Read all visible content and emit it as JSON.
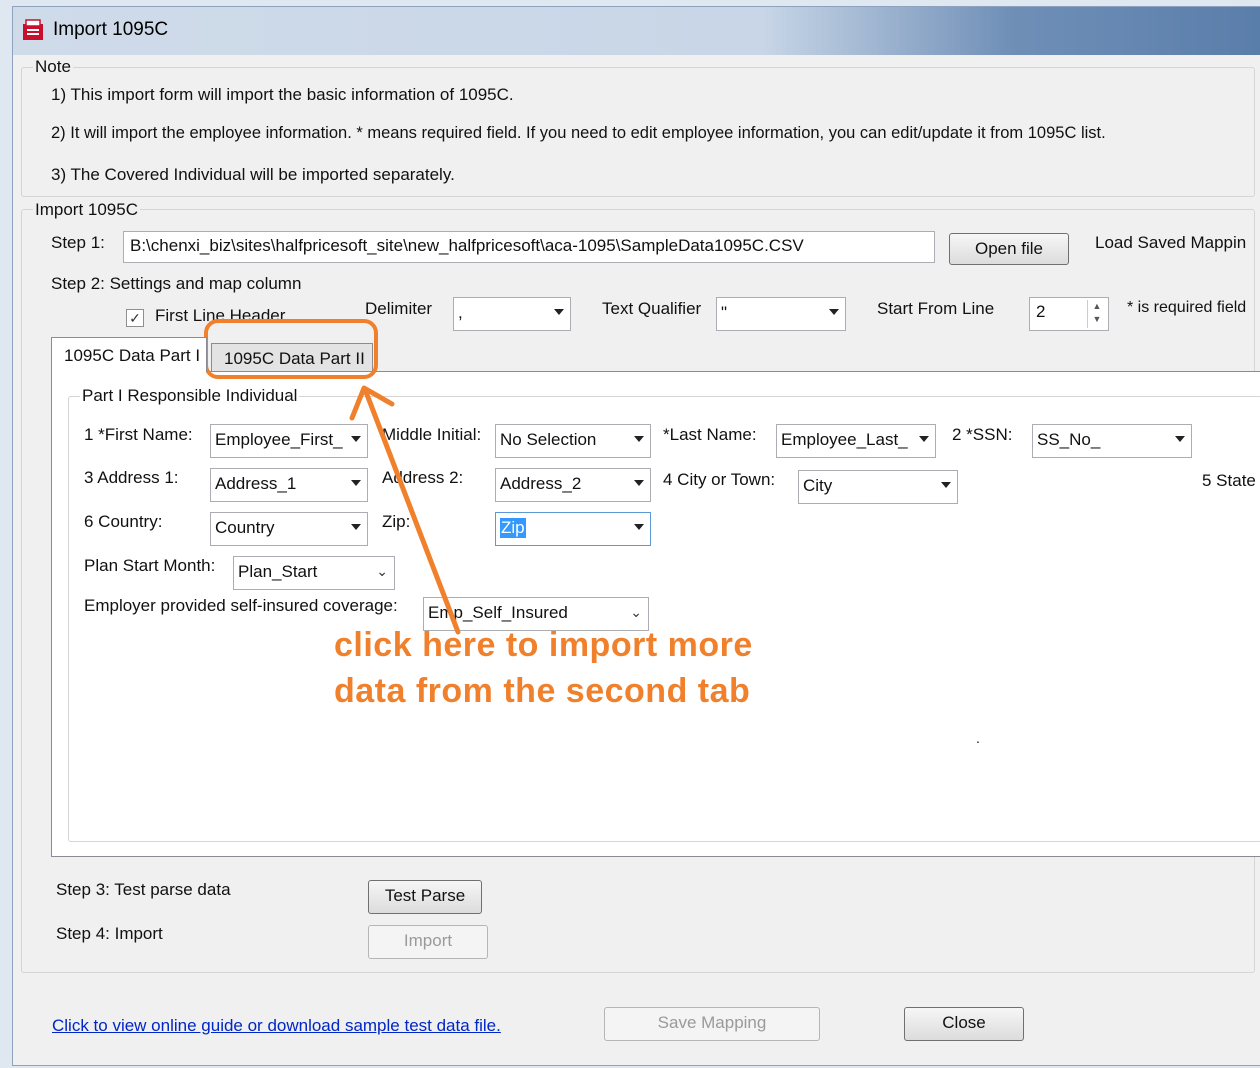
{
  "window": {
    "title": "Import 1095C"
  },
  "note": {
    "label": "Note",
    "line1": "1) This import form will import the basic information of 1095C.",
    "line2": "2) It will import the employee information. * means required field. If you need to edit employee information, you can edit/update it from 1095C list.",
    "line3": "3) The Covered Individual will be imported separately."
  },
  "import": {
    "label": "Import 1095C",
    "step1_label": "Step 1:",
    "file_path": "B:\\chenxi_biz\\sites\\halfpricesoft_site\\new_halfpricesoft\\aca-1095\\SampleData1095C.CSV",
    "open_file": "Open file",
    "load_saved_mapping": "Load Saved Mappin",
    "step2_label": "Step 2:  Settings and map column",
    "first_line_header": "First Line Header",
    "first_line_header_checked": true,
    "delimiter_label": "Delimiter",
    "delimiter_value": ",",
    "text_qualifier_label": "Text Qualifier",
    "text_qualifier_value": "\"",
    "start_from_line_label": "Start From Line",
    "start_from_line_value": "2",
    "required_note": "* is required field"
  },
  "tabs": [
    {
      "label": "1095C Data Part I",
      "active": true
    },
    {
      "label": "1095C Data Part II",
      "active": false
    }
  ],
  "part1": {
    "label": "Part I Responsible Individual",
    "first_name_label": "1 *First Name:",
    "first_name_value": "Employee_First_",
    "middle_initial_label": "Middle Initial:",
    "middle_initial_value": "No Selection",
    "last_name_label": "*Last Name:",
    "last_name_value": "Employee_Last_",
    "ssn_label": "2 *SSN:",
    "ssn_value": "SS_No_",
    "address1_label": "3 Address 1:",
    "address1_value": "Address_1",
    "address2_label": "Address 2:",
    "address2_value": "Address_2",
    "city_label": "4 City or Town:",
    "city_value": "City",
    "state_label": "5 State",
    "country_label": "6 Country:",
    "country_value": "Country",
    "zip_label": "Zip:",
    "zip_value": "Zip",
    "plan_start_label": "Plan Start Month:",
    "plan_start_value": "Plan_Start",
    "self_insured_label": "Employer provided self-insured coverage:",
    "self_insured_value": "Emp_Self_Insured"
  },
  "steps": {
    "step3_label": "Step 3: Test parse data",
    "test_parse": "Test Parse",
    "step4_label": "Step 4: Import",
    "import_button": "Import"
  },
  "footer": {
    "guide_link": "Click to view online guide or download sample test data file.",
    "save_mapping": "Save Mapping",
    "close": "Close"
  },
  "annotation": {
    "line1": "click here to import more",
    "line2": "data from the second tab",
    "color": "#f0802b"
  }
}
